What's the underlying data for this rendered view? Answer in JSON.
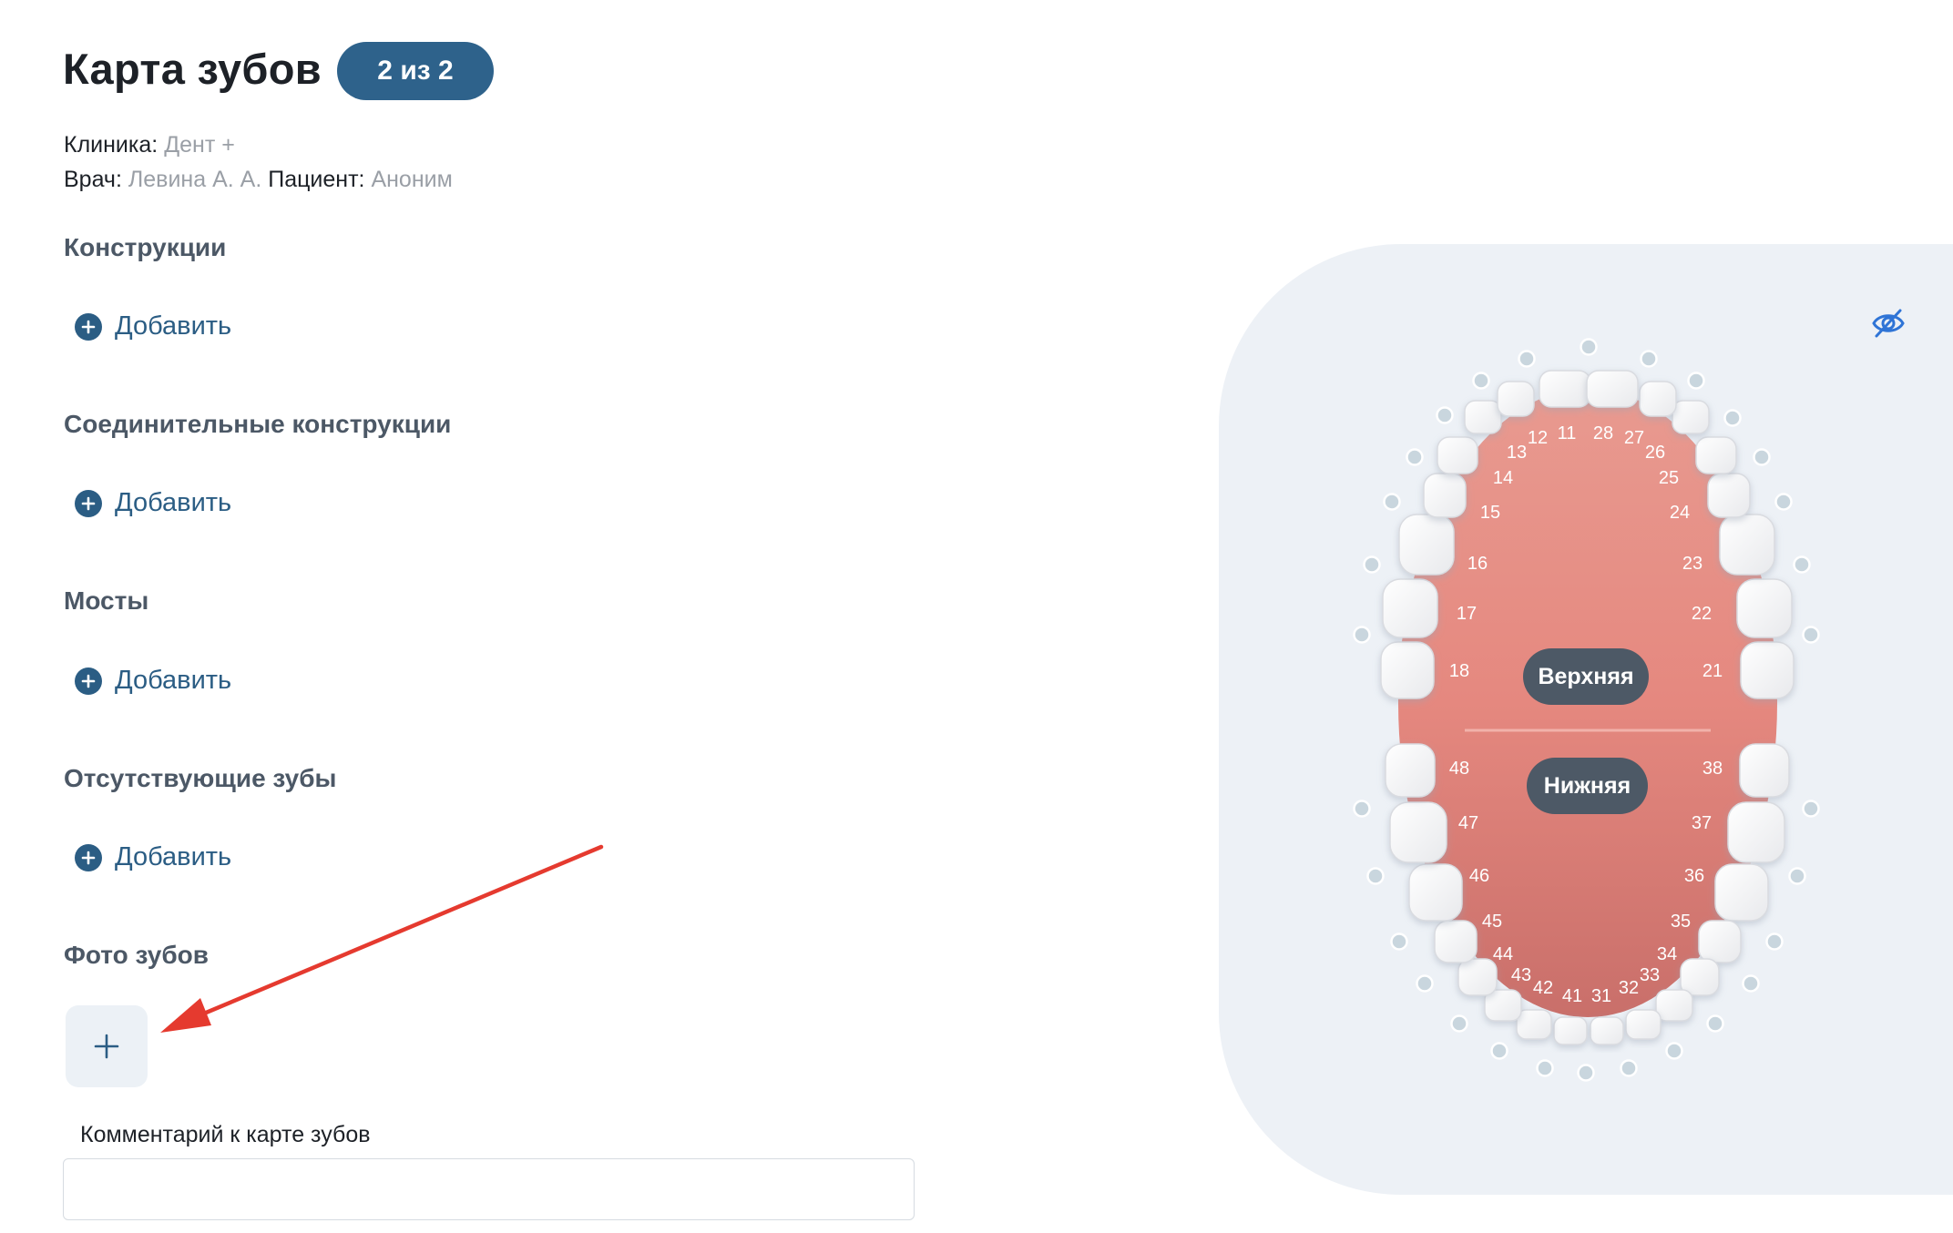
{
  "header": {
    "title": "Карта зубов",
    "badge": "2 из 2"
  },
  "info": {
    "clinic_label": "Клиника:",
    "clinic_value": "Дент +",
    "doctor_label": "Врач:",
    "doctor_value": "Левина А. А.",
    "patient_label": "Пациент:",
    "patient_value": "Аноним"
  },
  "sections": [
    {
      "title": "Конструкции",
      "add_label": "Добавить"
    },
    {
      "title": "Соединительные конструкции",
      "add_label": "Добавить"
    },
    {
      "title": "Мосты",
      "add_label": "Добавить"
    },
    {
      "title": "Отсутствующие зубы",
      "add_label": "Добавить"
    },
    {
      "title": "Фото зубов"
    }
  ],
  "comment": {
    "label": "Комментарий к карте зубов",
    "value": "",
    "placeholder": ""
  },
  "jaw": {
    "upper_label": "Верхняя",
    "lower_label": "Нижняя"
  },
  "tooth_numbers": {
    "upper_right": [
      "18",
      "17",
      "16",
      "15",
      "14",
      "13",
      "12",
      "11"
    ],
    "upper_left": [
      "21",
      "22",
      "23",
      "24",
      "25",
      "26",
      "27",
      "28"
    ],
    "lower_left": [
      "38",
      "37",
      "36",
      "35",
      "34",
      "33",
      "32",
      "31"
    ],
    "lower_right": [
      "41",
      "42",
      "43",
      "44",
      "45",
      "46",
      "47",
      "48"
    ]
  },
  "icons": {
    "visibility": "eye-off-icon",
    "add": "plus-circle-icon",
    "add_photo": "plus-icon"
  },
  "colors": {
    "accent": "#2b5d84",
    "badge": "#2e628b",
    "gum": "#e58f86",
    "panel": "#edf1f6",
    "annotation_arrow": "#e53a2f"
  }
}
